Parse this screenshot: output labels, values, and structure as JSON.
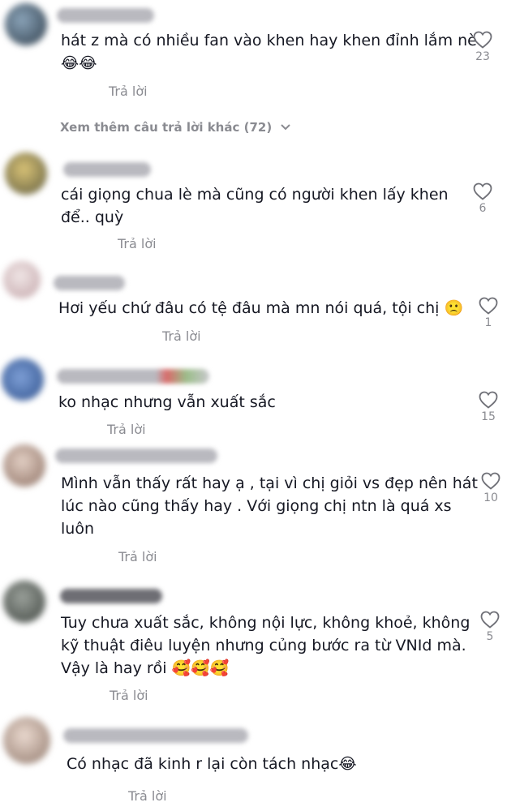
{
  "reply_label": "Trả lời",
  "view_more": "Xem thêm câu trả lời khác (72)",
  "comments": [
    {
      "text_lines": [
        "hát z mà có nhiều fan vào khen hay khen đỉnh lắm nè",
        "😂😂"
      ],
      "likes": "23"
    },
    {
      "text_lines": [
        "cái giọng chua lè mà cũng có người khen lấy khen",
        "để.. quỳ"
      ],
      "likes": "6"
    },
    {
      "text_lines": [
        "Hơi yếu chứ đâu có tệ đâu mà mn nói quá, tội chị 🙁"
      ],
      "likes": "1"
    },
    {
      "text_lines": [
        "ko nhạc nhưng vẫn xuất sắc"
      ],
      "likes": "15"
    },
    {
      "text_lines": [
        "Mình vẫn thấy rất hay ạ , tại vì chị giỏi vs đẹp nên hát",
        "lúc nào cũng thấy hay . Với giọng chị ntn là quá xs",
        "luôn"
      ],
      "likes": "10"
    },
    {
      "text_lines": [
        "Tuy chưa xuất sắc, không nội lực, không khoẻ, không",
        "kỹ thuật điêu luyện nhưng củng bước ra từ VNId mà.",
        "Vậy là hay rồi 🥰🥰🥰"
      ],
      "likes": "5"
    },
    {
      "text_lines": [
        "Có nhạc đã kinh r lại còn tách nhạc😂"
      ],
      "likes": ""
    }
  ]
}
